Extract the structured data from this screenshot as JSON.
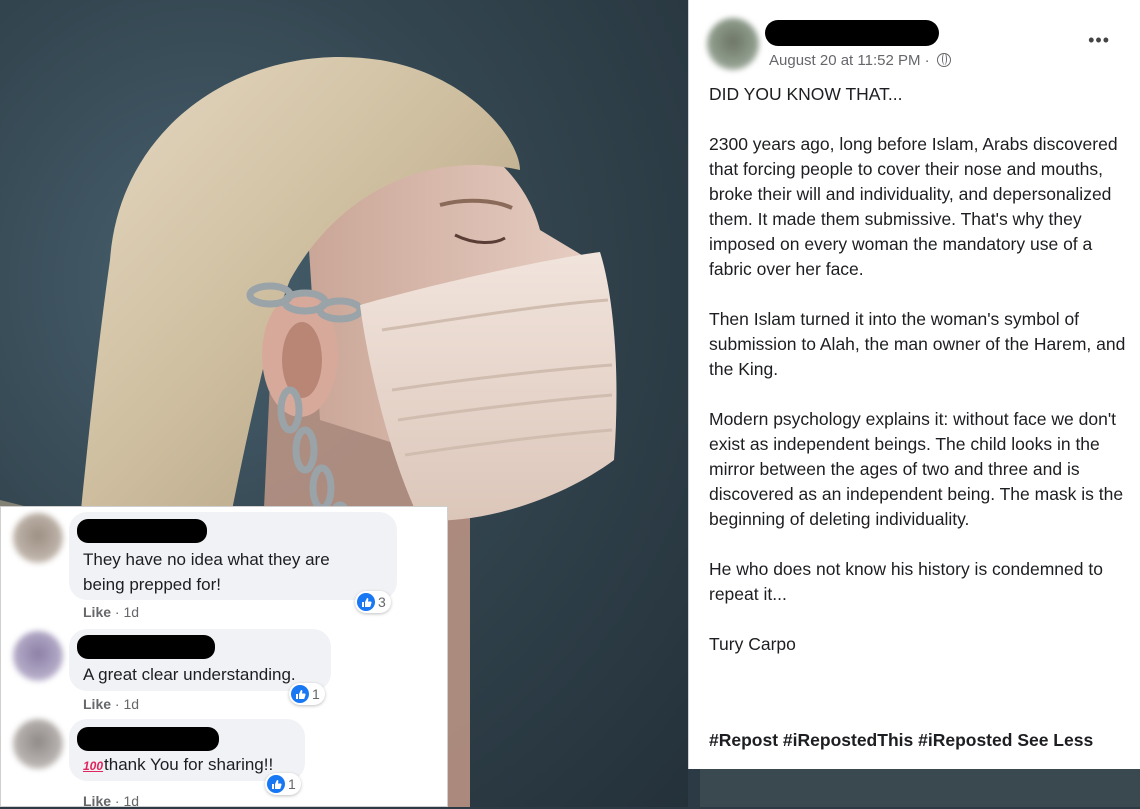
{
  "post": {
    "timestamp": "August 20 at 11:52 PM · ",
    "more_label": "•••",
    "paragraphs": [
      "DID YOU KNOW THAT...",
      "2300 years ago, long before Islam, Arabs discovered that forcing people to cover their nose and mouths, broke their will and individuality, and depersonalized them. It made them submissive. That's why they imposed on every woman the mandatory use of a fabric over her face.",
      "Then Islam turned it into the woman's symbol of submission to Alah, the man owner of the Harem, and the King.",
      "Modern psychology explains it: without face we don't exist as independent beings. The child looks in the mirror between the ages of two and three and is discovered as an independent being. The mask is the beginning of deleting individuality.",
      "He who does not know his history is condemned to repeat it...",
      "Tury Carpo"
    ],
    "tags": [
      "#Repost",
      "#iRepostedThis",
      "#iReposted"
    ],
    "see_less": "See Less"
  },
  "comments": [
    {
      "prefix": "",
      "text_lines": [
        "They have no idea what they are",
        "being prepped for!"
      ],
      "like": "Like",
      "age": " · 1d",
      "reactions": "3"
    },
    {
      "prefix": "",
      "text_lines": [
        "A great clear understanding."
      ],
      "like": "Like",
      "age": " · 1d",
      "reactions": "1"
    },
    {
      "prefix": "100",
      "text_lines": [
        "thank You for sharing!!"
      ],
      "like": "Like",
      "age": " · 1d",
      "reactions": "1"
    }
  ],
  "colors": {
    "link_blue": "#1877f2",
    "bubble": "#f0f2f5",
    "meta_gray": "#65676b"
  },
  "icons": {
    "privacy": "globe-icon",
    "reaction": "thumbs-up-icon",
    "emoji": "hundred-points-icon"
  }
}
